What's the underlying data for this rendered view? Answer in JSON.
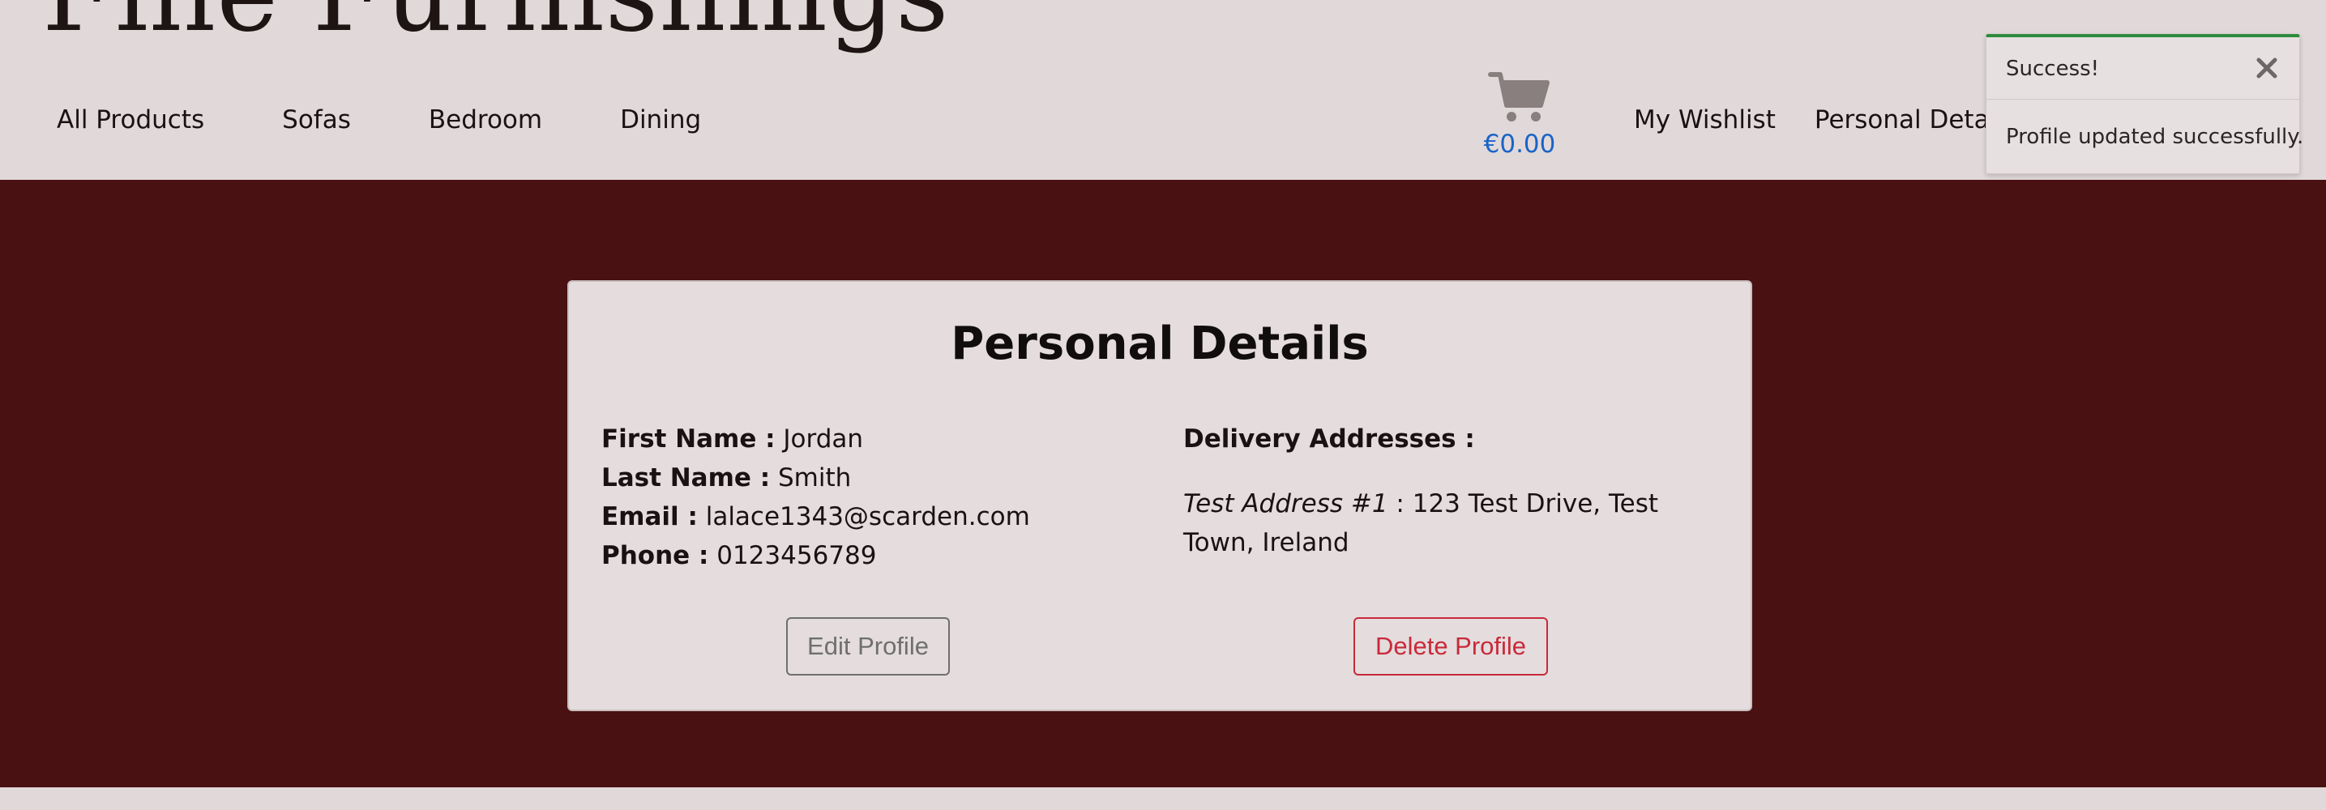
{
  "brand": {
    "name": "Fine Furnishings"
  },
  "nav": {
    "left": [
      {
        "label": "All Products"
      },
      {
        "label": "Sofas"
      },
      {
        "label": "Bedroom"
      },
      {
        "label": "Dining"
      }
    ],
    "cart": {
      "icon": "shopping-cart-icon",
      "total": "€0.00"
    },
    "right": [
      {
        "label": "My Wishlist"
      },
      {
        "label": "Personal Details"
      }
    ]
  },
  "toast": {
    "title": "Success!",
    "message": "Profile updated successfully.",
    "accent_color": "#2e8b3d",
    "close_icon": "close-icon"
  },
  "profile": {
    "title": "Personal Details",
    "first_name_label": "First Name :",
    "first_name": "Jordan",
    "last_name_label": "Last Name :",
    "last_name": "Smith",
    "email_label": "Email :",
    "email": "lalace1343@scarden.com",
    "phone_label": "Phone :",
    "phone": "0123456789",
    "addresses_label": "Delivery Addresses :",
    "addresses": [
      {
        "name": "Test Address #1",
        "separator": " : ",
        "detail": "123 Test Drive, Test Town, Ireland"
      }
    ],
    "edit_button": "Edit Profile",
    "delete_button": "Delete Profile"
  },
  "colors": {
    "page_bg": "#e1d9d9",
    "main_bg": "#4a1112",
    "card_bg": "#e4dcdd",
    "link_blue": "#1a64c8",
    "danger": "#c82a3a"
  }
}
